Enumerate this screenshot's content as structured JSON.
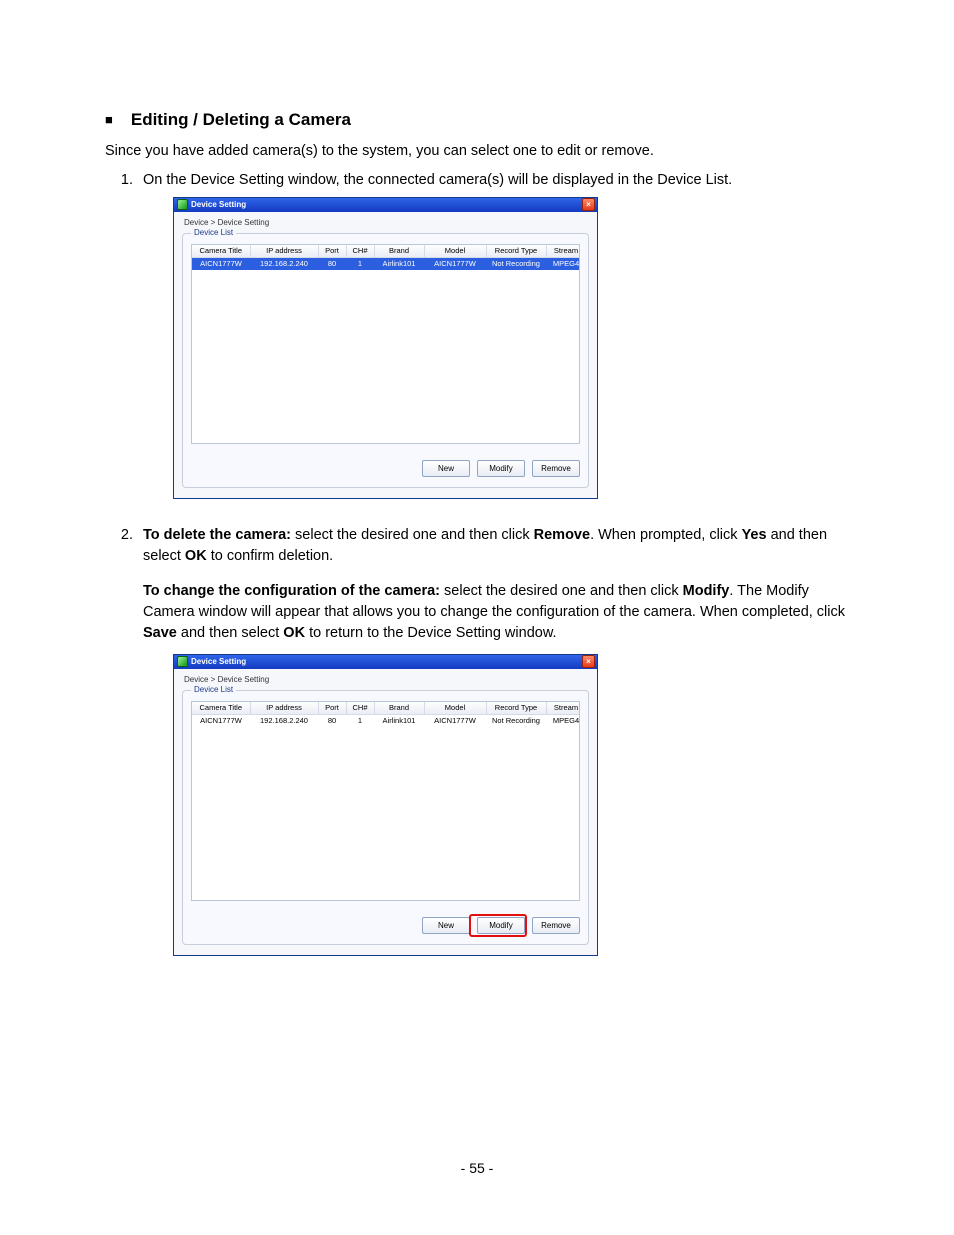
{
  "heading": "Editing / Deleting a Camera",
  "intro": "Since you have added camera(s) to the system, you can select one to edit or remove.",
  "step1": "On the Device Setting window, the connected camera(s) will be displayed in the Device List.",
  "step2": {
    "del_lead_bold": "To delete the camera:",
    "del_tail_1": " select the desired one and then click ",
    "del_bold_remove": "Remove",
    "del_tail_2": ". When prompted, click ",
    "del_bold_yes": "Yes",
    "del_tail_3": " and then select ",
    "del_bold_ok": "OK",
    "del_tail_4": " to confirm deletion.",
    "cfg_lead_bold": "To change the configuration of the camera:",
    "cfg_tail_1": " select the desired one and then click ",
    "cfg_bold_modify": "Modify",
    "cfg_tail_2": ". The Modify Camera window will appear that allows you to change the configuration of the camera. When completed, click ",
    "cfg_bold_save": "Save",
    "cfg_tail_3": " and then select ",
    "cfg_bold_ok": "OK",
    "cfg_tail_4": " to return to the Device Setting window."
  },
  "ds": {
    "title": "Device Setting",
    "close": "×",
    "breadcrumb": "Device > Device Setting",
    "group": "Device List",
    "headers": [
      "Camera Title",
      "IP address",
      "Port",
      "CH#",
      "Brand",
      "Model",
      "Record Type",
      "Stream"
    ],
    "row": [
      "AICN1777W",
      "192.168.2.240",
      "80",
      "1",
      "Airlink101",
      "AICN1777W",
      "Not Recording",
      "MPEG4"
    ],
    "btn_new": "New",
    "btn_modify": "Modify",
    "btn_remove": "Remove"
  },
  "page_number": "- 55 -"
}
